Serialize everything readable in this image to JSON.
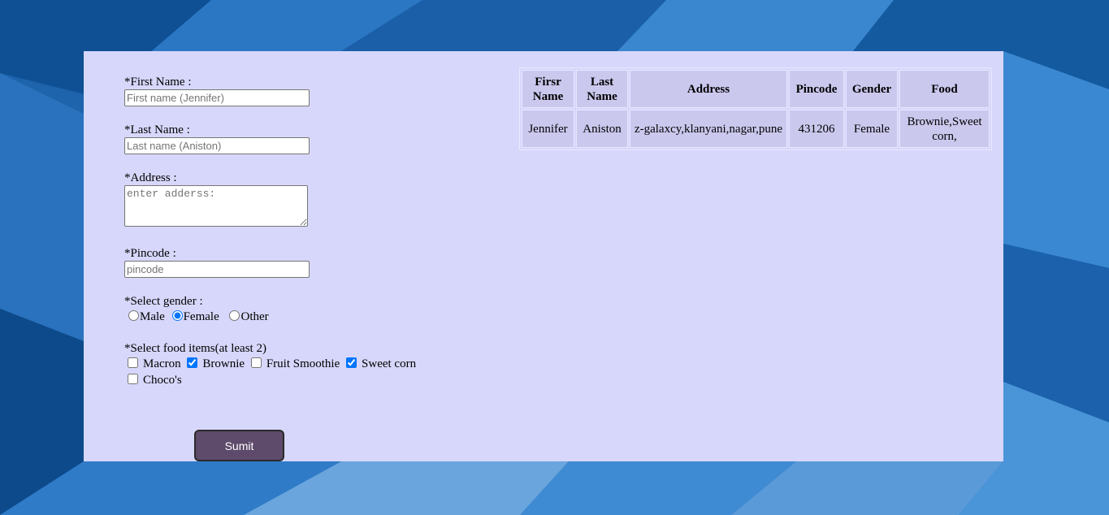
{
  "form": {
    "first_name": {
      "label": "*First Name :",
      "placeholder": "First name (Jennifer)",
      "value": ""
    },
    "last_name": {
      "label": "*Last Name :",
      "placeholder": "Last name (Aniston)",
      "value": ""
    },
    "address": {
      "label": "*Address :",
      "placeholder": "enter adderss:",
      "value": ""
    },
    "pincode": {
      "label": "*Pincode :",
      "placeholder": "pincode",
      "value": ""
    },
    "gender": {
      "label": "*Select gender :",
      "options": [
        {
          "label": "Male",
          "checked": false
        },
        {
          "label": "Female",
          "checked": true
        },
        {
          "label": "Other",
          "checked": false
        }
      ]
    },
    "food": {
      "label": "*Select food items(at least 2)",
      "options": [
        {
          "label": "Macron",
          "checked": false
        },
        {
          "label": "Brownie",
          "checked": true
        },
        {
          "label": "Fruit Smoothie",
          "checked": false
        },
        {
          "label": "Sweet corn",
          "checked": true
        },
        {
          "label": "Choco's",
          "checked": false
        }
      ]
    },
    "submit_label": "Sumit"
  },
  "table": {
    "headers": [
      "Firsr Name",
      "Last Name",
      "Address",
      "Pincode",
      "Gender",
      "Food"
    ],
    "rows": [
      [
        "Jennifer",
        "Aniston",
        "z-galaxcy,klanyani,nagar,pune",
        "431206",
        "Female",
        "Brownie,Sweet corn,"
      ]
    ]
  },
  "colors": {
    "panel_bg": "#d7d7fb",
    "cell_bg": "#cbc8ee",
    "button_bg": "#5e4a6b",
    "page_bg": "#1a63ad"
  }
}
